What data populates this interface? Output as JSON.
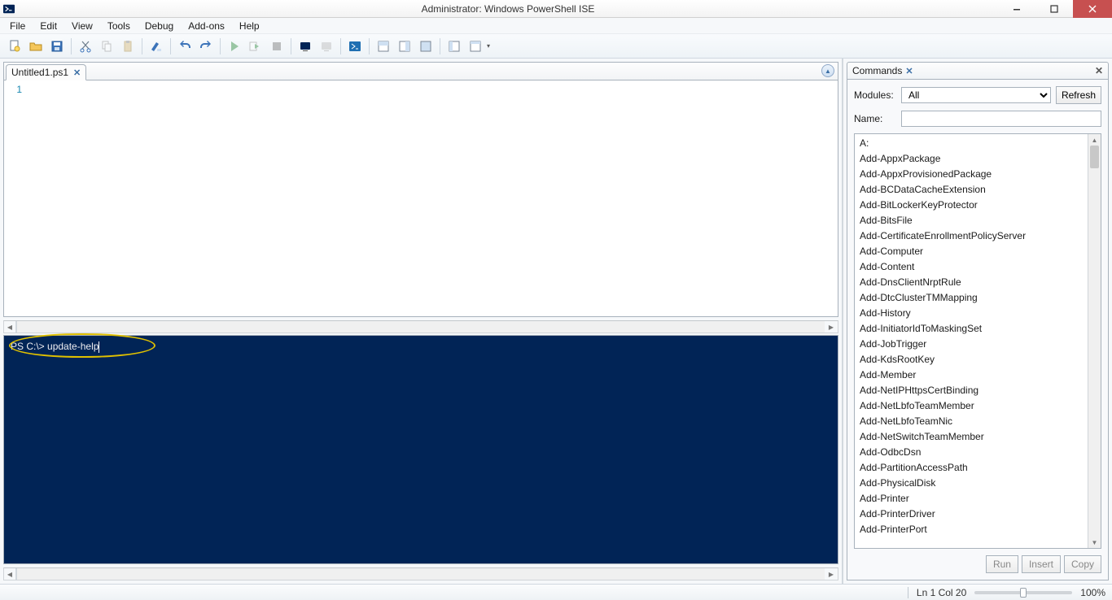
{
  "window": {
    "title": "Administrator: Windows PowerShell ISE"
  },
  "menu": {
    "items": [
      "File",
      "Edit",
      "View",
      "Tools",
      "Debug",
      "Add-ons",
      "Help"
    ]
  },
  "editor": {
    "tab": {
      "name": "Untitled1.ps1"
    },
    "line_number": "1",
    "content": ""
  },
  "console": {
    "prompt": "PS C:\\> ",
    "input": "update-help"
  },
  "commands_panel": {
    "title": "Commands",
    "modules_label": "Modules:",
    "modules_value": "All",
    "refresh": "Refresh",
    "name_label": "Name:",
    "name_value": "",
    "list": [
      "A:",
      "Add-AppxPackage",
      "Add-AppxProvisionedPackage",
      "Add-BCDataCacheExtension",
      "Add-BitLockerKeyProtector",
      "Add-BitsFile",
      "Add-CertificateEnrollmentPolicyServer",
      "Add-Computer",
      "Add-Content",
      "Add-DnsClientNrptRule",
      "Add-DtcClusterTMMapping",
      "Add-History",
      "Add-InitiatorIdToMaskingSet",
      "Add-JobTrigger",
      "Add-KdsRootKey",
      "Add-Member",
      "Add-NetIPHttpsCertBinding",
      "Add-NetLbfoTeamMember",
      "Add-NetLbfoTeamNic",
      "Add-NetSwitchTeamMember",
      "Add-OdbcDsn",
      "Add-PartitionAccessPath",
      "Add-PhysicalDisk",
      "Add-Printer",
      "Add-PrinterDriver",
      "Add-PrinterPort"
    ],
    "actions": {
      "run": "Run",
      "insert": "Insert",
      "copy": "Copy"
    }
  },
  "status": {
    "position": "Ln 1  Col 20",
    "zoom": "100%"
  }
}
